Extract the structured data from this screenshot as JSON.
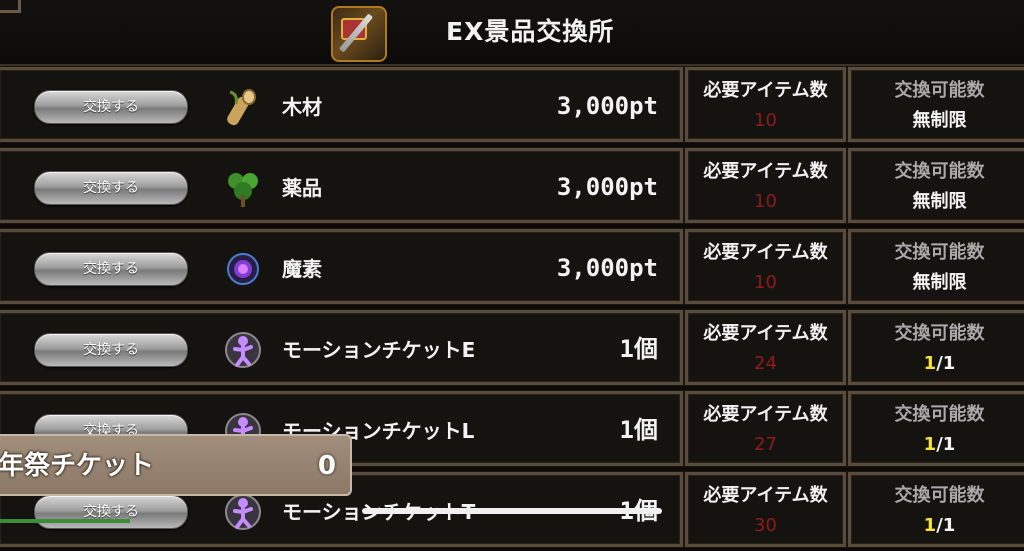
{
  "header": {
    "title": "EX景品交換所",
    "icon": "treasure-sword-icon"
  },
  "rows": [
    {
      "button": "交換する",
      "icon": "wood-icon",
      "name": "木材",
      "cost": "3,000pt",
      "need_label": "必要アイテム数",
      "need": "10",
      "limit_label": "交換可能数",
      "limit": "無制限",
      "limit_cur": "",
      "limit_max": ""
    },
    {
      "button": "交換する",
      "icon": "herb-icon",
      "name": "薬品",
      "cost": "3,000pt",
      "need_label": "必要アイテム数",
      "need": "10",
      "limit_label": "交換可能数",
      "limit": "無制限",
      "limit_cur": "",
      "limit_max": ""
    },
    {
      "button": "交換する",
      "icon": "magic-orb-icon",
      "name": "魔素",
      "cost": "3,000pt",
      "need_label": "必要アイテム数",
      "need": "10",
      "limit_label": "交換可能数",
      "limit": "無制限",
      "limit_cur": "",
      "limit_max": ""
    },
    {
      "button": "交換する",
      "icon": "motion-ticket-icon",
      "name": "モーションチケットE",
      "cost": "1個",
      "need_label": "必要アイテム数",
      "need": "24",
      "limit_label": "交換可能数",
      "limit": "",
      "limit_cur": "1",
      "limit_max": "/1"
    },
    {
      "button": "交換する",
      "icon": "motion-ticket-icon",
      "name": "モーションチケットL",
      "cost": "1個",
      "need_label": "必要アイテム数",
      "need": "27",
      "limit_label": "交換可能数",
      "limit": "",
      "limit_cur": "1",
      "limit_max": "/1"
    },
    {
      "button": "交換する",
      "icon": "motion-ticket-icon",
      "name": "モーションチケットT",
      "cost": "1個",
      "need_label": "必要アイテム数",
      "need": "30",
      "limit_label": "交換可能数",
      "limit": "",
      "limit_cur": "1",
      "limit_max": "/1"
    }
  ],
  "ticket": {
    "label": "年祭チケット",
    "value": "0"
  },
  "colors": {
    "need_value": "#8e1a1a",
    "limit_current": "#f5e23a",
    "panel_border": "#5a4c3d"
  }
}
